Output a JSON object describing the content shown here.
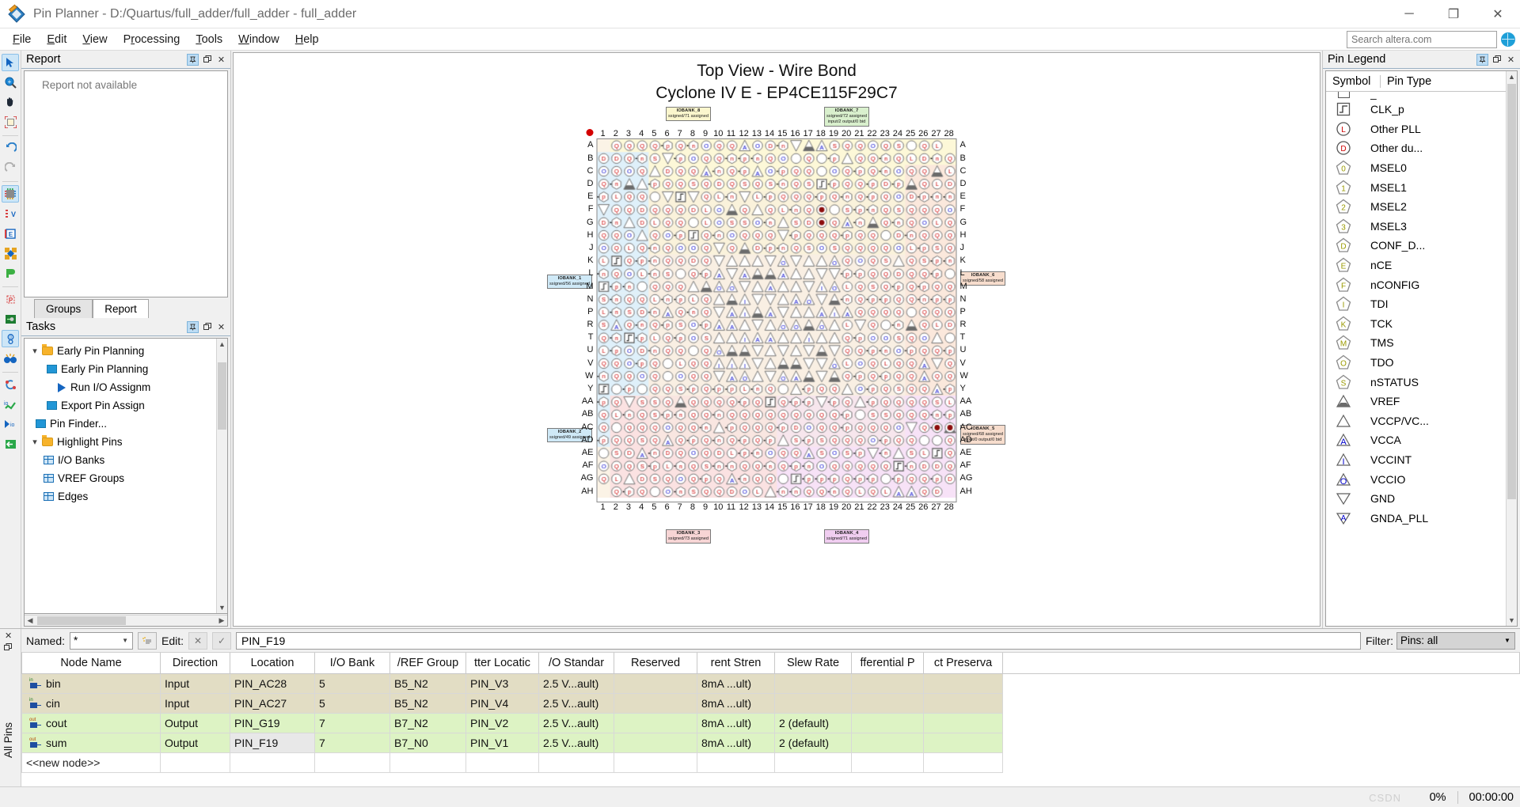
{
  "window": {
    "title": "Pin Planner - D:/Quartus/full_adder/full_adder - full_adder",
    "app_icon": "quartus-pin-planner-icon",
    "minimize_label": "─",
    "maximize_label": "❐",
    "close_label": "✕"
  },
  "menu": {
    "items": [
      {
        "label": "File",
        "accel": "F"
      },
      {
        "label": "Edit",
        "accel": "E"
      },
      {
        "label": "View",
        "accel": "V"
      },
      {
        "label": "Processing",
        "accel": "r"
      },
      {
        "label": "Tools",
        "accel": "T"
      },
      {
        "label": "Window",
        "accel": "W"
      },
      {
        "label": "Help",
        "accel": "H"
      }
    ],
    "search_placeholder": "Search altera.com"
  },
  "toolbar_icons": [
    {
      "name": "select-arrow-icon",
      "glyph": "➤",
      "selected": true
    },
    {
      "name": "zoom-icon",
      "glyph": "⊕",
      "selected": false
    },
    {
      "name": "pan-hand-icon",
      "glyph": "✋",
      "selected": false
    },
    {
      "name": "fit-in-window-icon",
      "glyph": "⛶",
      "selected": false
    },
    {
      "name": "undo-icon",
      "glyph": "↶",
      "selected": false
    },
    {
      "name": "redo-icon",
      "glyph": "↷",
      "selected": false
    },
    {
      "name": "package-view-icon",
      "glyph": "▦",
      "selected": true
    },
    {
      "name": "pad-view-icon",
      "glyph": "▤",
      "selected": false
    },
    {
      "name": "report-window-icon",
      "glyph": "▥",
      "selected": false
    },
    {
      "name": "groups-icon",
      "glyph": "❖",
      "selected": false
    },
    {
      "name": "bank-icon",
      "glyph": "⮞",
      "selected": false
    },
    {
      "name": "pin-finder-icon",
      "glyph": "P",
      "selected": false
    },
    {
      "name": "board-trace-icon",
      "glyph": "⎇",
      "selected": false
    },
    {
      "name": "show-io-standard-icon",
      "glyph": "ⓞ",
      "selected": true
    },
    {
      "name": "highlight-pins-icon",
      "glyph": "☿",
      "selected": false
    },
    {
      "name": "refresh-icon",
      "glyph": "↻",
      "selected": false
    },
    {
      "name": "io-check-icon",
      "glyph": "✓",
      "selected": false
    },
    {
      "name": "run-io-assignment-icon",
      "glyph": "▶",
      "selected": false
    },
    {
      "name": "export-icon",
      "glyph": "↪",
      "selected": false
    }
  ],
  "report_panel": {
    "title": "Report",
    "empty_text": "Report not available",
    "pin_btn": "📌",
    "float_btn": "❐",
    "close_btn": "✕"
  },
  "dock_tabs": [
    {
      "label": "Groups",
      "active": false
    },
    {
      "label": "Report",
      "active": true
    }
  ],
  "tasks_panel": {
    "title": "Tasks",
    "pin_btn": "📌",
    "float_btn": "❐",
    "close_btn": "✕",
    "items": [
      {
        "label": "Early Pin Planning",
        "indent": 0,
        "kind": "folder",
        "expanded": true
      },
      {
        "label": "Early Pin Planning",
        "indent": 1,
        "kind": "blue"
      },
      {
        "label": "Run I/O Assignm",
        "indent": 2,
        "kind": "play"
      },
      {
        "label": "Export Pin Assign",
        "indent": 1,
        "kind": "blue"
      },
      {
        "label": "Pin Finder...",
        "indent": 0,
        "kind": "blue"
      },
      {
        "label": "Highlight Pins",
        "indent": 0,
        "kind": "folder",
        "expanded": true
      },
      {
        "label": "I/O Banks",
        "indent": 1,
        "kind": "grid"
      },
      {
        "label": "VREF Groups",
        "indent": 1,
        "kind": "grid"
      },
      {
        "label": "Edges",
        "indent": 1,
        "kind": "grid"
      }
    ]
  },
  "chip_view": {
    "title_line1": "Top View - Wire Bond",
    "title_line2": "Cyclone IV E - EP4CE115F29C7",
    "col_labels": [
      "1",
      "2",
      "3",
      "4",
      "5",
      "6",
      "7",
      "8",
      "9",
      "10",
      "11",
      "12",
      "13",
      "14",
      "15",
      "16",
      "17",
      "18",
      "19",
      "20",
      "21",
      "22",
      "23",
      "24",
      "25",
      "26",
      "27",
      "28"
    ],
    "row_labels": [
      "A",
      "B",
      "C",
      "D",
      "E",
      "F",
      "G",
      "H",
      "J",
      "K",
      "L",
      "M",
      "N",
      "P",
      "R",
      "T",
      "U",
      "V",
      "W",
      "Y",
      "AA",
      "AB",
      "AC",
      "AD",
      "AE",
      "AF",
      "AG",
      "AH"
    ],
    "banks": [
      {
        "id": "IOBANK_8",
        "detail": "ssigned/71 assigned",
        "color": "#fbf6cd",
        "pos": "top-left"
      },
      {
        "id": "IOBANK_7",
        "detail": "ssigned/72 assigned",
        "detail2": "input/2 output/0 bid",
        "color": "#d9f0cd",
        "pos": "top-right"
      },
      {
        "id": "IOBANK_1",
        "detail": "ssigned/56 assigned",
        "color": "#cfe9f7",
        "pos": "left-upper"
      },
      {
        "id": "IOBANK_2",
        "detail": "ssigned/49 assigned",
        "color": "#cfe9f7",
        "pos": "left-lower"
      },
      {
        "id": "IOBANK_6",
        "detail": "ssigned/58 assigned",
        "color": "#f7ddcd",
        "pos": "right-upper"
      },
      {
        "id": "IOBANK_5",
        "detail": "ssigned/68 assigned",
        "detail2": "input/0 output/0 bid",
        "color": "#f7ddcd",
        "pos": "right-lower"
      },
      {
        "id": "IOBANK_3",
        "detail": "ssigned/73 assigned",
        "color": "#f7d5d5",
        "pos": "bottom-left"
      },
      {
        "id": "IOBANK_4",
        "detail": "ssigned/71 assigned",
        "color": "#f0cdf0",
        "pos": "bottom-right"
      }
    ]
  },
  "pin_legend": {
    "title": "Pin Legend",
    "pin_btn": "📌",
    "float_btn": "❐",
    "close_btn": "✕",
    "columns": [
      "Symbol",
      "Pin Type"
    ],
    "rows": [
      {
        "type": "CLK_p",
        "sym": "square",
        "glyph": "⎍",
        "color": "#555555"
      },
      {
        "type": "Other PLL",
        "sym": "circle",
        "glyph": "L",
        "color": "#cc0000"
      },
      {
        "type": "Other du...",
        "sym": "circle",
        "glyph": "D",
        "color": "#cc0000"
      },
      {
        "type": "MSEL0",
        "sym": "pentagon",
        "glyph": "0",
        "color": "#9a9a00"
      },
      {
        "type": "MSEL1",
        "sym": "pentagon",
        "glyph": "1",
        "color": "#9a9a00"
      },
      {
        "type": "MSEL2",
        "sym": "pentagon",
        "glyph": "2",
        "color": "#9a9a00"
      },
      {
        "type": "MSEL3",
        "sym": "pentagon",
        "glyph": "3",
        "color": "#9a9a00"
      },
      {
        "type": "CONF_D...",
        "sym": "pentagon",
        "glyph": "D",
        "color": "#9a9a00"
      },
      {
        "type": "nCE",
        "sym": "pentagon",
        "glyph": "E",
        "color": "#9a9a00"
      },
      {
        "type": "nCONFIG",
        "sym": "pentagon",
        "glyph": "F",
        "color": "#9a9a00"
      },
      {
        "type": "TDI",
        "sym": "pentagon",
        "glyph": "I",
        "color": "#9a9a00"
      },
      {
        "type": "TCK",
        "sym": "pentagon",
        "glyph": "K",
        "color": "#9a9a00"
      },
      {
        "type": "TMS",
        "sym": "pentagon",
        "glyph": "M",
        "color": "#9a9a00"
      },
      {
        "type": "TDO",
        "sym": "pentagon",
        "glyph": "O",
        "color": "#9a9a00"
      },
      {
        "type": "nSTATUS",
        "sym": "pentagon",
        "glyph": "S",
        "color": "#9a9a00"
      },
      {
        "type": "VREF",
        "sym": "tri-filled",
        "glyph": "",
        "color": "#606060"
      },
      {
        "type": "VCCP/VC...",
        "sym": "tri",
        "glyph": "",
        "color": "#606060"
      },
      {
        "type": "VCCA",
        "sym": "tri",
        "glyph": "A",
        "color": "#0000cc"
      },
      {
        "type": "VCCINT",
        "sym": "tri",
        "glyph": "I",
        "color": "#0000cc"
      },
      {
        "type": "VCCIO",
        "sym": "tri",
        "glyph": "O",
        "color": "#0000cc"
      },
      {
        "type": "GND",
        "sym": "tri-down",
        "glyph": "",
        "color": "#606060"
      },
      {
        "type": "GNDA_PLL",
        "sym": "tri-down",
        "glyph": "A",
        "color": "#0000cc"
      }
    ]
  },
  "bottom_pane": {
    "side_label": "All Pins",
    "named_label": "Named:",
    "named_value": "*",
    "edit_label": "Edit:",
    "edit_value": "PIN_F19",
    "filter_label": "Filter:",
    "filter_value": "Pins: all",
    "cancel_btn": "✕",
    "accept_btn": "✓",
    "wand_icon": "✨",
    "columns": [
      "Node Name",
      "Direction",
      "Location",
      "I/O Bank",
      "/REF Group",
      "tter Locatic",
      "/O Standar",
      "Reserved",
      "rent Stren",
      "Slew Rate",
      "fferential P",
      "ct Preserva"
    ],
    "rows": [
      {
        "node": "bin",
        "icon": "in",
        "direction": "Input",
        "location": "PIN_AC28",
        "bank": "5",
        "vref": "B5_N2",
        "fitter": "PIN_V3",
        "iostd": "2.5 V...ault)",
        "reserved": "",
        "strength": "8mA ...ult)",
        "slew": "",
        "diff": "",
        "preserve": "",
        "style": "in-row"
      },
      {
        "node": "cin",
        "icon": "in",
        "direction": "Input",
        "location": "PIN_AC27",
        "bank": "5",
        "vref": "B5_N2",
        "fitter": "PIN_V4",
        "iostd": "2.5 V...ault)",
        "reserved": "",
        "strength": "8mA ...ult)",
        "slew": "",
        "diff": "",
        "preserve": "",
        "style": "in-row"
      },
      {
        "node": "cout",
        "icon": "out",
        "direction": "Output",
        "location": "PIN_G19",
        "bank": "7",
        "vref": "B7_N2",
        "fitter": "PIN_V2",
        "iostd": "2.5 V...ault)",
        "reserved": "",
        "strength": "8mA ...ult)",
        "slew": "2 (default)",
        "diff": "",
        "preserve": "",
        "style": "out-row"
      },
      {
        "node": "sum",
        "icon": "out",
        "direction": "Output",
        "location": "PIN_F19",
        "bank": "7",
        "vref": "B7_N0",
        "fitter": "PIN_V1",
        "iostd": "2.5 V...ault)",
        "reserved": "",
        "strength": "8mA ...ult)",
        "slew": "2 (default)",
        "diff": "",
        "preserve": "",
        "style": "out-row",
        "selected_col": 2
      },
      {
        "node": "<<new node>>",
        "icon": "none",
        "direction": "",
        "location": "",
        "bank": "",
        "vref": "",
        "fitter": "",
        "iostd": "",
        "reserved": "",
        "strength": "",
        "slew": "",
        "diff": "",
        "preserve": "",
        "style": "new-row"
      }
    ]
  },
  "status_bar": {
    "progress": "0%",
    "time": "00:00:00",
    "watermark": "CSDN"
  },
  "colors": {
    "accent": "#1e9fd8",
    "input_row": "#e2ddc4",
    "output_row": "#ddf3c4",
    "bank_top_left": "#fbf6cd",
    "bank_top_right": "#d9f0cd",
    "bank_left": "#cfe9f7",
    "bank_right": "#f7ddcd",
    "bank_bottom_left": "#f7d5d5",
    "bank_bottom_right": "#f0cdf0"
  }
}
